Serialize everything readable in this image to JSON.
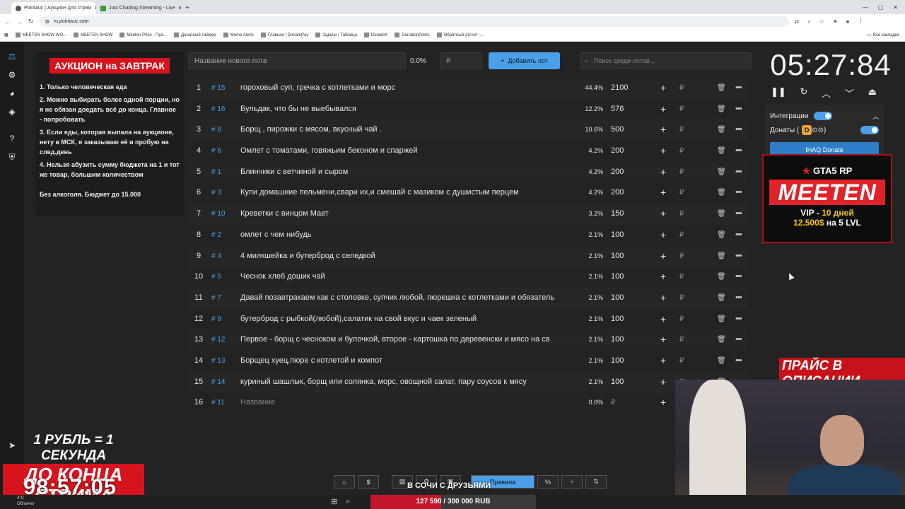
{
  "browser": {
    "tabs": [
      {
        "title": "Pointauc | Аукцион для стрим",
        "active": true
      },
      {
        "title": "Just Chatting Streaming - Live",
        "active": false
      }
    ],
    "url": "ru.pointauc.com",
    "bookmarks": [
      "MEETEN SHOW WO...",
      "MEETEN SHOW",
      "Meeten Price - Пра...",
      "Донатный таймер",
      "Meme Alerts",
      "Главная | DonatePay",
      "Задачи | Таблица",
      "DonateX",
      "DonationAlerts",
      "Обратный отсчет -..."
    ],
    "all_bookmarks": "Все закладки"
  },
  "rules": {
    "title": "АУКЦИОН на ЗАВТРАК",
    "items": [
      "1. Только человеческая еда",
      "2. Можно выбирать более одной порции, но я не обязан доедать всё до конца. Главное - попробовать",
      "3. Если еды, которая выпала на аукционе, нету в МСК, я заказываю её и пробую на след.день",
      "4. Нельзя абузить сумму бюджета на 1 и тот же товар, большим количеством"
    ],
    "footer": "Без алкоголя. Бюджет до 15.000"
  },
  "toolbar": {
    "lot_name_placeholder": "Название нового лота",
    "percent": "0.0%",
    "currency": "₽",
    "add_label": "Добавить лот",
    "search_placeholder": "Поиск среди лотов..."
  },
  "lots": [
    {
      "num": "1",
      "id": "# 15",
      "name": "гороховый суп, гречка с котлетками и морс",
      "pct": "44.4%",
      "amount": "2100"
    },
    {
      "num": "2",
      "id": "# 16",
      "name": "Бульдак, что бы не выебывался",
      "pct": "12.2%",
      "amount": "576"
    },
    {
      "num": "3",
      "id": "# 8",
      "name": "Борщ , пирожки с мясом, вкусный чай .",
      "pct": "10.6%",
      "amount": "500"
    },
    {
      "num": "4",
      "id": "# 6",
      "name": "Омлет с томатами, говяжьим беконом и спаржей",
      "pct": "4.2%",
      "amount": "200"
    },
    {
      "num": "5",
      "id": "# 1",
      "name": "Блинчики с ветчиной и сыром",
      "pct": "4.2%",
      "amount": "200"
    },
    {
      "num": "6",
      "id": "# 3",
      "name": "Купи домашние пельмени,свари их,и смешай с мазиком с душистым перцем",
      "pct": "4.2%",
      "amount": "200"
    },
    {
      "num": "7",
      "id": "# 10",
      "name": "Креветки с винцом Мает",
      "pct": "3.2%",
      "amount": "150"
    },
    {
      "num": "8",
      "id": "# 2",
      "name": "омлет с чем нибудь",
      "pct": "2.1%",
      "amount": "100"
    },
    {
      "num": "9",
      "id": "# 4",
      "name": "4 милкшейка и бутерброд с селедкой",
      "pct": "2.1%",
      "amount": "100"
    },
    {
      "num": "10",
      "id": "# 5",
      "name": "Чеснок хлеб дошик чай",
      "pct": "2.1%",
      "amount": "100"
    },
    {
      "num": "11",
      "id": "# 7",
      "name": "Давай позавтракаем как с столовке, супчик любой, пюрешка с котлетками и обязатель",
      "pct": "2.1%",
      "amount": "100"
    },
    {
      "num": "12",
      "id": "# 9",
      "name": "бутерброд с рыбкой(любой),салатик на свой вкус и чаек зеленый",
      "pct": "2.1%",
      "amount": "100"
    },
    {
      "num": "13",
      "id": "# 12",
      "name": " Первое - борщ с чесноком и булочкой, второе - картошка по деревенски и мясо на св",
      "pct": "2.1%",
      "amount": "100"
    },
    {
      "num": "14",
      "id": "# 13",
      "name": "Борщец хуец,пюре с котлетой и компот",
      "pct": "2.1%",
      "amount": "100"
    },
    {
      "num": "15",
      "id": "# 14",
      "name": "куриный шашлык, борщ или солянка, морс, овощной салат, пару соусов к мясу",
      "pct": "2.1%",
      "amount": "100"
    }
  ],
  "new_lot": {
    "num": "16",
    "id": "# 11",
    "placeholder": "Название",
    "pct": "0.0%",
    "currency": "₽"
  },
  "timer": {
    "value": "05:27:84"
  },
  "integrations": {
    "label": "Интеграции",
    "donations_label": "Донаты (",
    "donations_badge": "D",
    "ihaq_label": "IHAQ Donate"
  },
  "bottom_bar": {
    "rules_label": "Правила",
    "percent_label": "%",
    "dollar_label": "$"
  },
  "overlays": {
    "gta_logo": "GTA5 RP",
    "gta_name": "MEETEN",
    "gta_vip_prefix": "VIP - ",
    "gta_vip_days": "10 дней",
    "gta_vip_price": "12.500$",
    "gta_vip_suffix": " на 5 LVL",
    "price_note": "ПРАЙС В ОПИСАНИИ",
    "rub_line1": "1 РУБЛЬ = 1 СЕКУНДА",
    "rub_line2": "ДО КОНЦА СТРИМА",
    "stream_timer": "98:57:05",
    "sochi": "В СОЧИ С ДРУЗЬЯМИ",
    "goal_text": "127 590 / 300 000 RUB",
    "goal_progress": 0.4253
  },
  "taskbar": {
    "weather_temp": "4°C",
    "weather_desc": "Облачно"
  },
  "colors": {
    "accent": "#4a9fe8",
    "brand_red": "#d7141e",
    "background": "#232323"
  }
}
